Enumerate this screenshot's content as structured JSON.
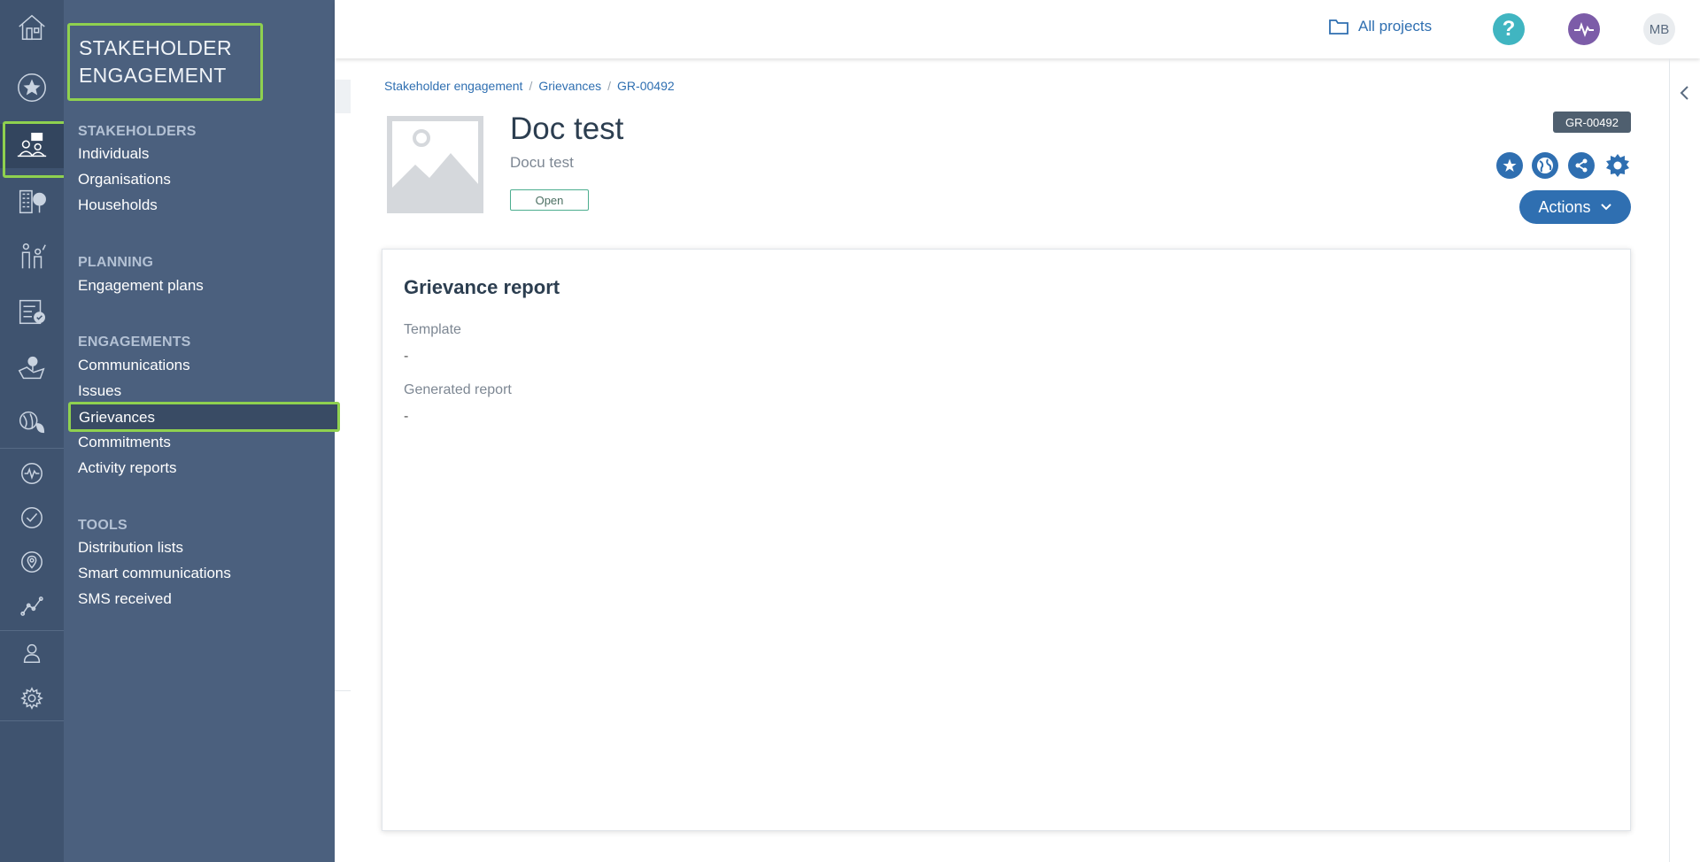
{
  "rail": {
    "items": [
      {
        "icon": "home-icon"
      },
      {
        "icon": "star-icon"
      },
      {
        "icon": "stakeholder-engagement-icon",
        "active": true
      },
      {
        "icon": "buildings-icon"
      },
      {
        "icon": "people-icon"
      },
      {
        "icon": "checklist-icon"
      },
      {
        "icon": "map-location-icon"
      },
      {
        "icon": "biodiversity-icon"
      },
      {
        "icon": "activity-icon"
      },
      {
        "icon": "check-circle-icon"
      },
      {
        "icon": "location-pin-icon"
      },
      {
        "icon": "line-chart-icon"
      },
      {
        "icon": "user-icon"
      },
      {
        "icon": "settings-icon"
      }
    ]
  },
  "menu": {
    "title": "STAKEHOLDER ENGAGEMENT",
    "sections": [
      {
        "label": "STAKEHOLDERS",
        "items": [
          "Individuals",
          "Organisations",
          "Households"
        ]
      },
      {
        "label": "PLANNING",
        "items": [
          "Engagement plans"
        ]
      },
      {
        "label": "ENGAGEMENTS",
        "items": [
          "Communications",
          "Issues",
          "Grievances",
          "Commitments",
          "Activity reports"
        ]
      },
      {
        "label": "TOOLS",
        "items": [
          "Distribution lists",
          "Smart communications",
          "SMS received"
        ]
      }
    ],
    "active_item": "Grievances"
  },
  "topbar": {
    "all_projects_label": "All projects",
    "help_label": "?",
    "avatar_initials": "MB"
  },
  "breadcrumb": [
    "Stakeholder engagement",
    "Grievances",
    "GR-00492"
  ],
  "record": {
    "title": "Doc test",
    "subtitle": "Docu test",
    "status": "Open",
    "reference": "GR-00492",
    "actions_label": "Actions"
  },
  "card": {
    "title": "Grievance report",
    "fields": [
      {
        "label": "Template",
        "value": "-"
      },
      {
        "label": "Generated report",
        "value": "-"
      }
    ]
  },
  "colors": {
    "rail_bg": "#3f536f",
    "menu_bg": "#4b607e",
    "highlight": "#8fd14f",
    "primary": "#2f6fb1",
    "help": "#40b5c1",
    "pulse": "#7c5ca8"
  }
}
